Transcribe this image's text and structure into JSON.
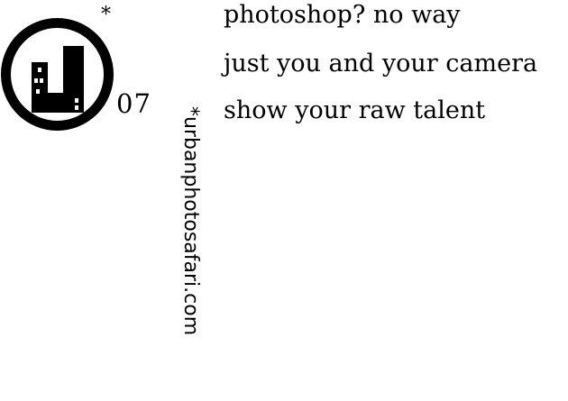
{
  "brand": {
    "logo_icon": "urban-u-building-icon",
    "logo_asterisk": "*",
    "issue_number": "07",
    "vertical_asterisk": "*",
    "vertical_site": "urbanphotosafari.com"
  },
  "taglines": [
    "photoshop? no way",
    "just you and your camera",
    "show your raw talent"
  ],
  "colors": {
    "ink": "#000000",
    "background": "#ffffff"
  }
}
